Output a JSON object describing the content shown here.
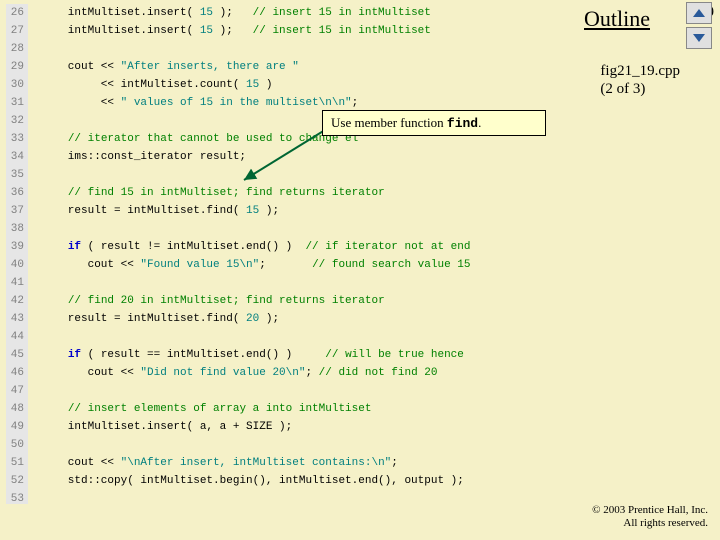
{
  "page_number": "50",
  "outline_label": "Outline",
  "fig_label_line1": "fig21_19.cpp",
  "fig_label_line2": "(2 of 3)",
  "callout_prefix": "Use member function ",
  "callout_func": "find",
  "callout_suffix": ".",
  "copyright_line1": "© 2003 Prentice Hall, Inc.",
  "copyright_line2": "All rights reserved.",
  "line_start": 26,
  "line_end": 53,
  "code_lines": [
    {
      "n": 26,
      "seg": [
        [
          "",
          "   intMultiset.insert( "
        ],
        [
          "num",
          "15"
        ],
        [
          "",
          " );   "
        ],
        [
          "cmt",
          "// insert 15 in intMultiset"
        ]
      ]
    },
    {
      "n": 27,
      "seg": [
        [
          "",
          "   intMultiset.insert( "
        ],
        [
          "num",
          "15"
        ],
        [
          "",
          " );   "
        ],
        [
          "cmt",
          "// insert 15 in intMultiset"
        ]
      ]
    },
    {
      "n": 28,
      "seg": []
    },
    {
      "n": 29,
      "seg": [
        [
          "",
          "   cout << "
        ],
        [
          "str",
          "\"After inserts, there are \""
        ]
      ]
    },
    {
      "n": 30,
      "seg": [
        [
          "",
          "        << intMultiset.count( "
        ],
        [
          "num",
          "15"
        ],
        [
          "",
          " )"
        ]
      ]
    },
    {
      "n": 31,
      "seg": [
        [
          "",
          "        << "
        ],
        [
          "str",
          "\" values of 15 in the multiset\\n\\n\""
        ],
        [
          "",
          ";"
        ]
      ]
    },
    {
      "n": 32,
      "seg": []
    },
    {
      "n": 33,
      "seg": [
        [
          "",
          "   "
        ],
        [
          "cmt",
          "// iterator that cannot be used to change el"
        ]
      ]
    },
    {
      "n": 34,
      "seg": [
        [
          "",
          "   ims::const_iterator result;"
        ]
      ]
    },
    {
      "n": 35,
      "seg": []
    },
    {
      "n": 36,
      "seg": [
        [
          "",
          "   "
        ],
        [
          "cmt",
          "// find 15 in intMultiset; find returns iterator"
        ]
      ]
    },
    {
      "n": 37,
      "seg": [
        [
          "",
          "   result = intMultiset.find( "
        ],
        [
          "num",
          "15"
        ],
        [
          "",
          " );"
        ]
      ]
    },
    {
      "n": 38,
      "seg": []
    },
    {
      "n": 39,
      "seg": [
        [
          "",
          "   "
        ],
        [
          "kw",
          "if"
        ],
        [
          "",
          " ( result != intMultiset.end() )  "
        ],
        [
          "cmt",
          "// if iterator not at end"
        ]
      ]
    },
    {
      "n": 40,
      "seg": [
        [
          "",
          "      cout << "
        ],
        [
          "str",
          "\"Found value 15\\n\""
        ],
        [
          "",
          ";       "
        ],
        [
          "cmt",
          "// found search value 15"
        ]
      ]
    },
    {
      "n": 41,
      "seg": []
    },
    {
      "n": 42,
      "seg": [
        [
          "",
          "   "
        ],
        [
          "cmt",
          "// find 20 in intMultiset; find returns iterator"
        ]
      ]
    },
    {
      "n": 43,
      "seg": [
        [
          "",
          "   result = intMultiset.find( "
        ],
        [
          "num",
          "20"
        ],
        [
          "",
          " );"
        ]
      ]
    },
    {
      "n": 44,
      "seg": []
    },
    {
      "n": 45,
      "seg": [
        [
          "",
          "   "
        ],
        [
          "kw",
          "if"
        ],
        [
          "",
          " ( result == intMultiset.end() )     "
        ],
        [
          "cmt",
          "// will be true hence"
        ]
      ]
    },
    {
      "n": 46,
      "seg": [
        [
          "",
          "      cout << "
        ],
        [
          "str",
          "\"Did not find value 20\\n\""
        ],
        [
          "",
          ";"
        ],
        [
          "cmt",
          " // did not find 20"
        ]
      ]
    },
    {
      "n": 47,
      "seg": []
    },
    {
      "n": 48,
      "seg": [
        [
          "",
          "   "
        ],
        [
          "cmt",
          "// insert elements of array a into intMultiset"
        ]
      ]
    },
    {
      "n": 49,
      "seg": [
        [
          "",
          "   intMultiset.insert( a, a + SIZE );"
        ]
      ]
    },
    {
      "n": 50,
      "seg": []
    },
    {
      "n": 51,
      "seg": [
        [
          "",
          "   cout << "
        ],
        [
          "str",
          "\"\\nAfter insert, intMultiset contains:\\n\""
        ],
        [
          "",
          ";"
        ]
      ]
    },
    {
      "n": 52,
      "seg": [
        [
          "",
          "   std::copy( intMultiset.begin(), intMultiset.end(), output );"
        ]
      ]
    },
    {
      "n": 53,
      "seg": []
    }
  ]
}
